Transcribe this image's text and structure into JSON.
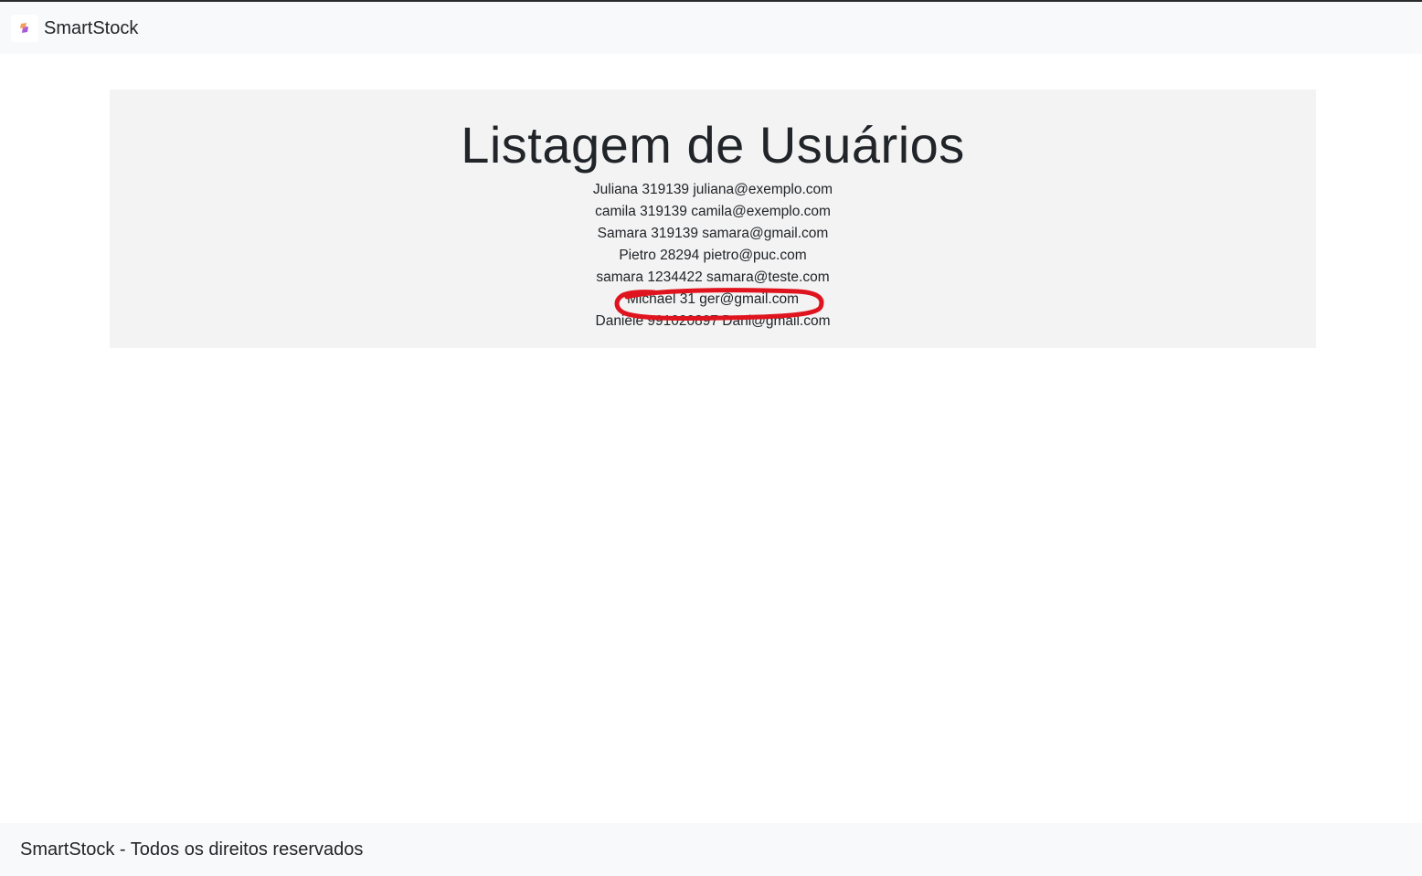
{
  "navbar": {
    "brand": "SmartStock",
    "logo_icon": "smartstock-logo-icon"
  },
  "main": {
    "title": "Listagem de Usuários",
    "users": [
      "Juliana 319139 juliana@exemplo.com",
      "camila 319139 camila@exemplo.com",
      "Samara 319139 samara@gmail.com",
      "Pietro 28294 pietro@puc.com",
      "samara 1234422 samara@teste.com",
      "Michael 31 ger@gmail.com",
      "Daniele 991020897 Dani@gmail.com"
    ],
    "highlighted_index": 5,
    "annotation_color": "#e0141e"
  },
  "footer": {
    "text": "SmartStock - Todos os direitos reservados"
  },
  "colors": {
    "navbar_bg": "#f8f9fa",
    "panel_bg": "#f3f3f3",
    "text": "#212529"
  }
}
